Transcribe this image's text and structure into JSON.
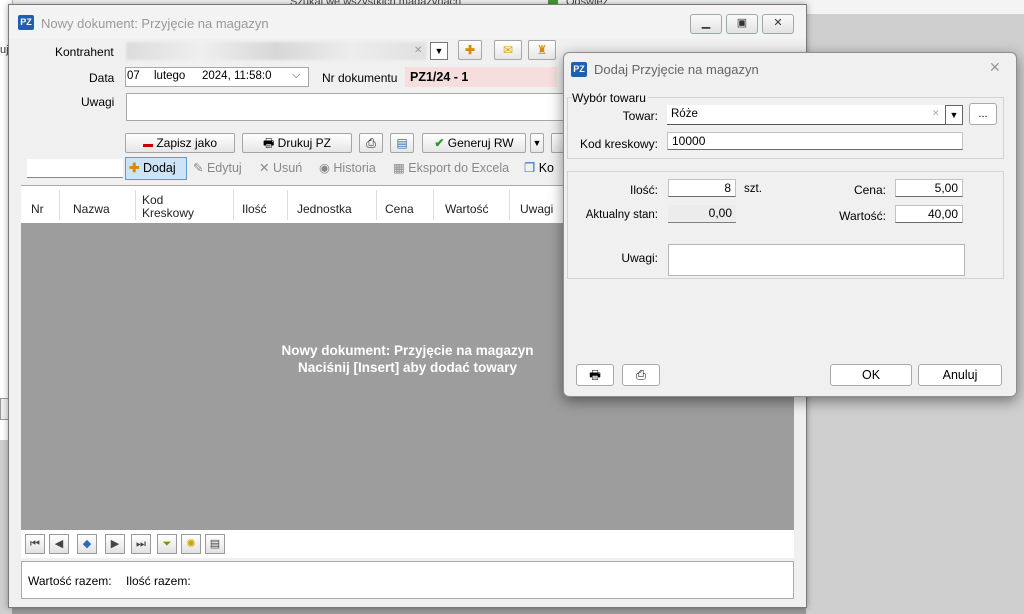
{
  "background": {
    "top_strip_text": "Szukaj we wszystkich magazynach",
    "top_strip_right": "Odśwież",
    "left_strip_text": "uj"
  },
  "main_window": {
    "title": "Nowy dokument: Przyjęcie na magazyn",
    "app_badge": "PZ",
    "form": {
      "kontrahent_label": "Kontrahent",
      "data_label": "Data",
      "date_day": "07",
      "date_month": "lutego",
      "date_rest": "2024,  11:58:0",
      "nr_label": "Nr dokumentu",
      "nr_value": "PZ1/24 - 1",
      "uwagi_label": "Uwagi"
    },
    "actions": {
      "save_as": "Zapisz jako",
      "print_pz": "Drukuj PZ",
      "generate_rw": "Generuj RW"
    },
    "toolbar": {
      "add": "Dodaj",
      "edit": "Edytuj",
      "delete": "Usuń",
      "history": "Historia",
      "export": "Eksport do Excela",
      "copy": "Ko"
    },
    "columns": [
      "Nr",
      "Nazwa",
      "Kod\nKreskowy",
      "Ilość",
      "Jednostka",
      "Cena",
      "Wartość",
      "Uwagi"
    ],
    "empty_message_line1": "Nowy dokument: Przyjęcie na magazyn",
    "empty_message_line2": "Naciśnij [Insert] aby dodać towary",
    "footer": {
      "total_value_label": "Wartość razem:",
      "total_qty_label": "Ilość razem:"
    }
  },
  "dialog": {
    "title": "Dodaj Przyjęcie na magazyn",
    "app_badge": "PZ",
    "group_title": "Wybór towaru",
    "towar_label": "Towar:",
    "towar_value": "Róże",
    "browse_label": "...",
    "barcode_label": "Kod kreskowy:",
    "barcode_value": "10000",
    "qty_label": "Ilość:",
    "qty_value": "8",
    "qty_unit": "szt.",
    "stock_label": "Aktualny stan:",
    "stock_value": "0,00",
    "price_label": "Cena:",
    "price_value": "5,00",
    "value_label": "Wartość:",
    "value_value": "40,00",
    "notes_label": "Uwagi:",
    "ok_label": "OK",
    "cancel_label": "Anuluj"
  },
  "colors": {
    "nr_dokumentu_bg": "#f6dede",
    "add_button_bg": "#cde4f7",
    "grid_bg": "#9d9d9d"
  }
}
